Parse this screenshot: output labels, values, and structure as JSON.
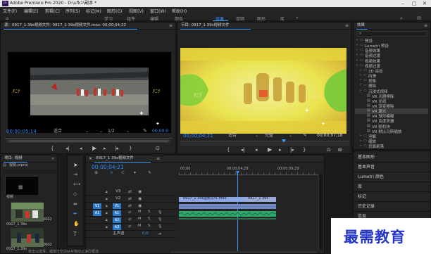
{
  "window": {
    "title": "Adobe Premiere Pro 2020 - D:\\ufk1\\副本 *",
    "logo": "Pr",
    "controls": [
      "minimize-icon",
      "maximize-icon",
      "close-icon"
    ]
  },
  "menu": [
    "文件(F)",
    "编辑(E)",
    "剪辑(C)",
    "序列(S)",
    "标记(M)",
    "图形(G)",
    "视图(V)",
    "窗口(W)",
    "帮助(H)"
  ],
  "workspaces": {
    "items": [
      "学习",
      "组件",
      "编辑",
      "颜色",
      "效果",
      "音频",
      "图形",
      "库"
    ],
    "active": "效果"
  },
  "source_monitor": {
    "tab": "源：0917_1 39s视频文件: 0917_1 39s视频文件.mov: 00;00;04;22",
    "timecode_in": "00;00;05;14",
    "fit": "适合",
    "zoom": "1/2",
    "timecode_out": "00;00;0"
  },
  "program_monitor": {
    "tab": "节目: 0917_1 39s视频文件",
    "timecode_in": "00;00;04;21",
    "fit": "适合",
    "quality": "完整",
    "timecode_out": "00;00;07;18"
  },
  "effects_panel": {
    "title": "效果",
    "search_placeholder": "",
    "items": [
      {
        "label": "预设",
        "indent": 1,
        "selected": false
      },
      {
        "label": "Lumetri 预设",
        "indent": 1,
        "selected": false
      },
      {
        "label": "音频效果",
        "indent": 1,
        "selected": false
      },
      {
        "label": "音频过渡",
        "indent": 1,
        "selected": false
      },
      {
        "label": "视频效果",
        "indent": 1,
        "selected": false
      },
      {
        "label": "视频过渡",
        "indent": 1,
        "selected": false
      },
      {
        "label": "3D 运动",
        "indent": 2,
        "selected": false
      },
      {
        "label": "内滑",
        "indent": 2,
        "selected": false
      },
      {
        "label": "划像",
        "indent": 2,
        "selected": false
      },
      {
        "label": "擦除",
        "indent": 2,
        "selected": false
      },
      {
        "label": "沉浸式视频",
        "indent": 2,
        "selected": false
      },
      {
        "label": "VR 光圈擦除",
        "indent": 3,
        "selected": false
      },
      {
        "label": "VR 光线",
        "indent": 3,
        "selected": false
      },
      {
        "label": "VR 渐变擦除",
        "indent": 3,
        "selected": false
      },
      {
        "label": "VR 漏光",
        "indent": 3,
        "selected": true
      },
      {
        "label": "VR 球形模糊",
        "indent": 3,
        "selected": false
      },
      {
        "label": "VR 色度泄漏",
        "indent": 3,
        "selected": false
      },
      {
        "label": "VR 随机块",
        "indent": 3,
        "selected": false
      },
      {
        "label": "VR 默比乌斯缩放",
        "indent": 3,
        "selected": false
      },
      {
        "label": "溶解",
        "indent": 2,
        "selected": false
      },
      {
        "label": "缩放",
        "indent": 2,
        "selected": false
      },
      {
        "label": "页面剥落",
        "indent": 2,
        "selected": false
      }
    ]
  },
  "side_panels": [
    "基本图形",
    "基本声音",
    "Lumetri 颜色",
    "库",
    "标记",
    "历史记录",
    "信息"
  ],
  "project_panel": {
    "tab": "项目: 视频",
    "file": "视频.prproj",
    "clips": [
      {
        "name": "视频",
        "duration": ""
      },
      {
        "name": "0917_1 39s",
        "duration": "2602"
      },
      {
        "name": "0917_1 39s",
        "duration": "2602"
      }
    ]
  },
  "timeline": {
    "tab": "0917_1 39s视频文件",
    "timecode": "00;00;04;21",
    "ruler": [
      "00;00",
      "00;00;04;29",
      "00;00;09;29"
    ],
    "video_tracks": [
      "V3",
      "V2",
      "V1"
    ],
    "audio_tracks": [
      "A1",
      "A2",
      "A3"
    ],
    "master": {
      "label": "主声道",
      "value": "0.0"
    },
    "clip_v1_label": "0917_1 39s视频文件.mov",
    "clip_v1b_label": "0917_1 39s",
    "source_patch": {
      "video": "V1",
      "audio": "A1"
    }
  },
  "status_bar": "单击以选择，或单击空白处并拖动以进行框选",
  "watermark": "最需教育",
  "colors": {
    "accent": "#3d95ff",
    "clip_video": "#7b95d6",
    "clip_audio": "#2fa86c",
    "track_patch": "#2e79c7"
  }
}
